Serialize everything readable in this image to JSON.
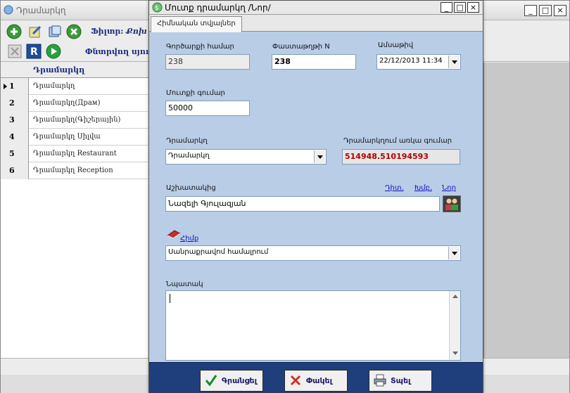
{
  "background_window": {
    "title": "Դրամարկղ",
    "filter_label": "Ֆիլտր:",
    "filter_value": "Քոխ",
    "toolbar2_label": "Փնտրվող սյուն",
    "grid": {
      "header": "Դրամարկղ",
      "rows": [
        {
          "num": "1",
          "name": "Դրամարկղ"
        },
        {
          "num": "2",
          "name": "Դրամարկղ(Драм)"
        },
        {
          "num": "3",
          "name": "Դրամարկղ(Գիշերային)"
        },
        {
          "num": "4",
          "name": "Դրամարկղ Սիլվա"
        },
        {
          "num": "5",
          "name": "Դրամարկղ Restaurant"
        },
        {
          "num": "6",
          "name": "Դրամարկղ Reception"
        }
      ]
    }
  },
  "dialog": {
    "title": "Մուտք դրամարկղ /Նոր/",
    "tab": "Հիմնական տվյալներ",
    "fields": {
      "op_number_label": "Գործարքի համար",
      "op_number_value": "238",
      "doc_number_label": "Փաստաթղթի N",
      "doc_number_value": "238",
      "date_label": "Ամսաթիվ",
      "date_value": "22/12/2013 11:34",
      "amount_label": "Մուտքի գումար",
      "amount_value": "50000",
      "cashbox_label": "Դրամարկղ",
      "cashbox_value": "Դրամարկղ",
      "balance_label": "Դրամարկղում առկա գումար",
      "balance_value": "514948.510194593",
      "employee_label": "Աշխատակից",
      "employee_value": "Նազելի Գյուլազյան",
      "link_view": "Դիտ.",
      "link_edit": "Խմբ.",
      "link_new": "Նոր",
      "link_change": "Հիմք",
      "basis_value": "Սանրաքրավոմ համալրում",
      "note_label": "Նպատակ",
      "note_value": ""
    },
    "footer": {
      "save": "Գրանցել",
      "close": "Փակել",
      "print": "Տպել"
    }
  }
}
